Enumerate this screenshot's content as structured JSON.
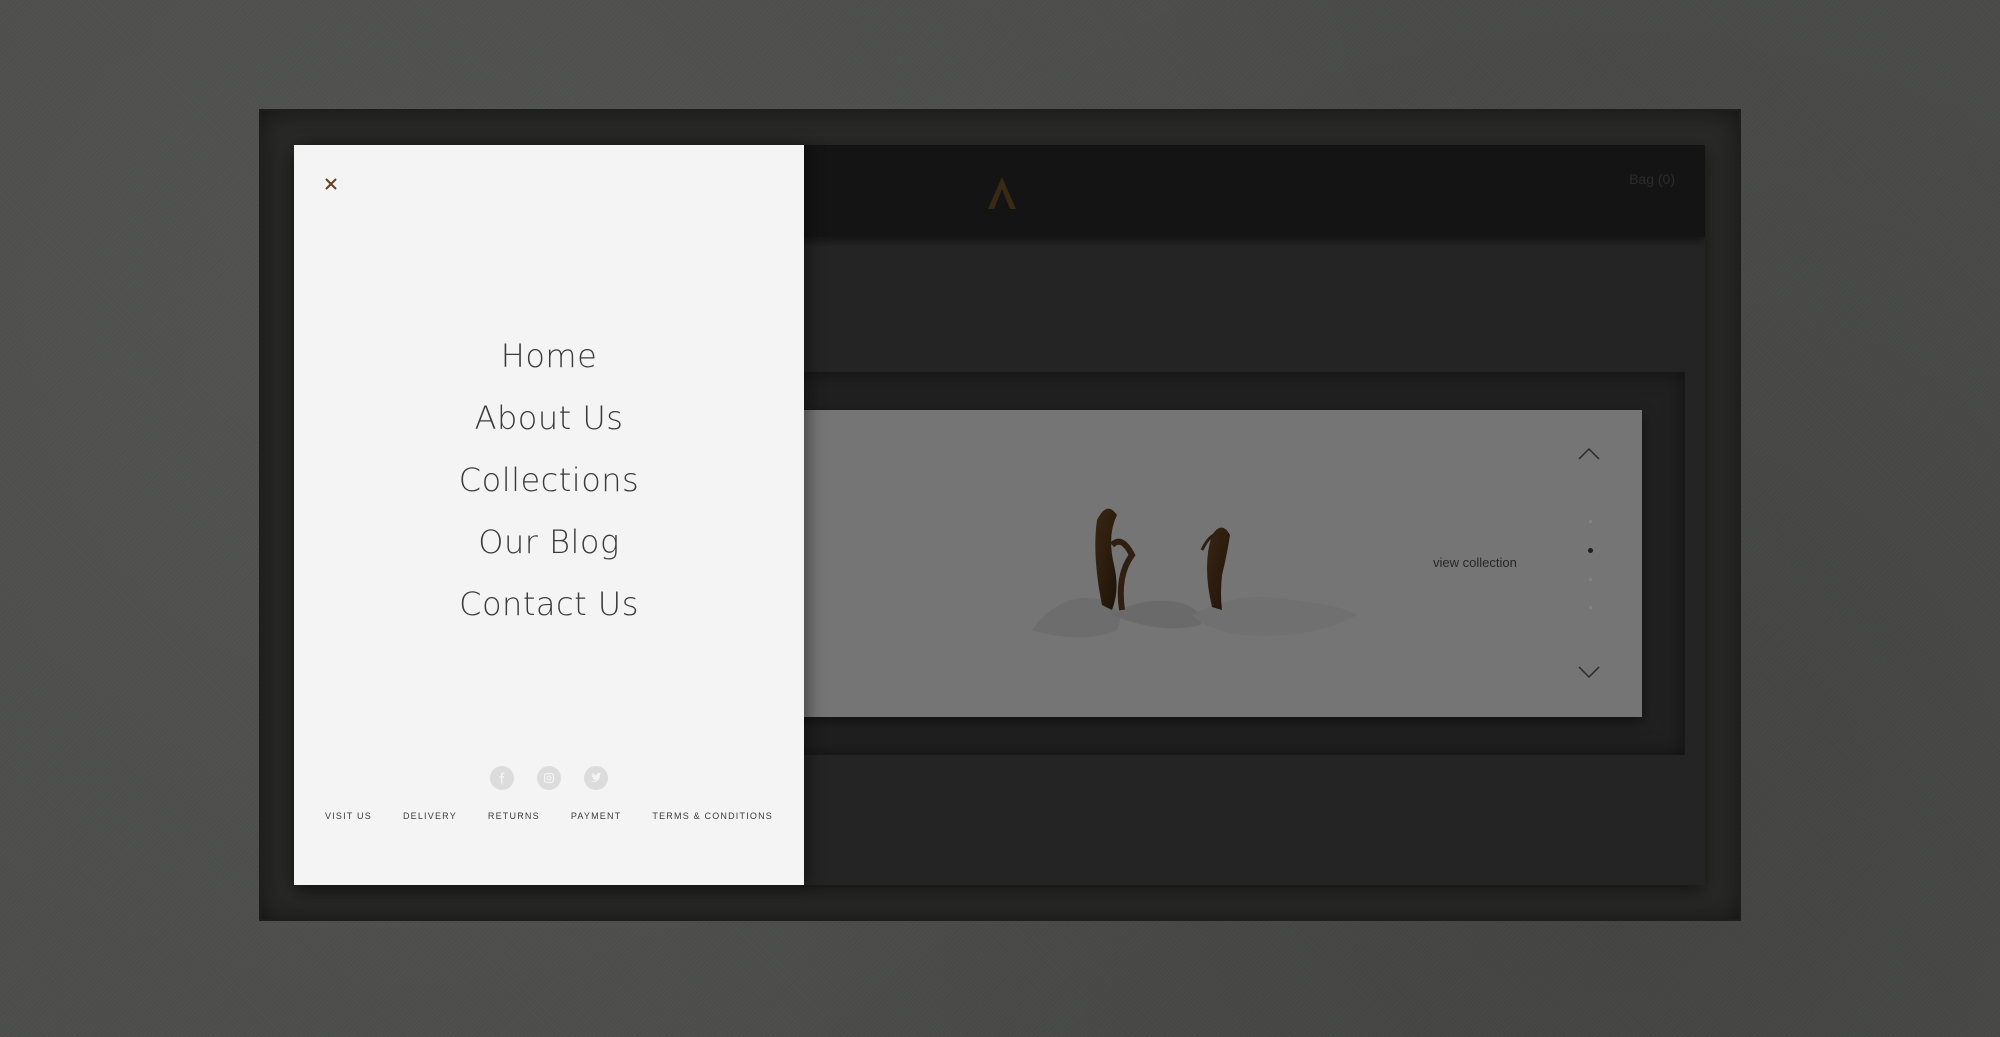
{
  "site": {
    "header": {
      "bag_label": "Bag (0)"
    },
    "slider": {
      "cta_label": "view collection",
      "slide_count": 4,
      "active_slide": 2
    }
  },
  "menu": {
    "close_icon": "close-icon",
    "items": [
      {
        "label": "Home"
      },
      {
        "label": "About Us"
      },
      {
        "label": "Collections"
      },
      {
        "label": "Our Blog"
      },
      {
        "label": "Contact Us"
      }
    ],
    "social": [
      "facebook-icon",
      "instagram-icon",
      "twitter-icon"
    ],
    "footer_links": [
      {
        "label": "VISIT US"
      },
      {
        "label": "DELIVERY"
      },
      {
        "label": "RETURNS"
      },
      {
        "label": "PAYMENT"
      },
      {
        "label": "TERMS & CONDITIONS"
      }
    ]
  },
  "colors": {
    "accent_brown": "#6b3f1d",
    "menu_background": "#f4f4f4",
    "overlay": "#262626",
    "backdrop": "#4b4c49"
  }
}
